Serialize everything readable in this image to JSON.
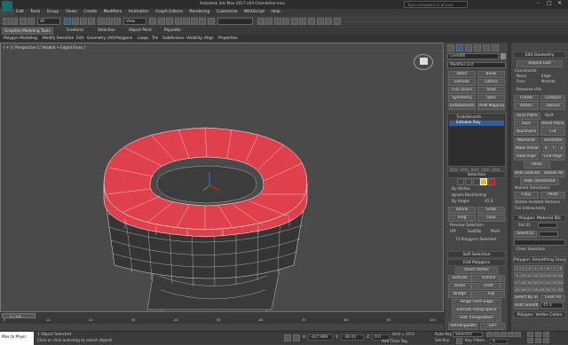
{
  "title": "Autodesk 3ds Max 2017 x64    Chandelier.max",
  "search_placeholder": "Type a keyword or phrase",
  "menu": [
    "Edit",
    "Tools",
    "Group",
    "Views",
    "Create",
    "Modifiers",
    "Animation",
    "Graph Editors",
    "Rendering",
    "Customize",
    "MAXScript",
    "Help"
  ],
  "toolbar": {
    "selection_set": "All",
    "view": "View"
  },
  "ribbon": {
    "tabs": [
      "Graphite Modeling Tools",
      "Freeform",
      "Selection",
      "Object Paint",
      "Populate"
    ],
    "sub": [
      "Polygon Modeling",
      "Modify Selection",
      "Edit",
      "Geometry (All)",
      "Polygons",
      "Loops",
      "Tris",
      "Subdivision",
      "Visibility",
      "Align",
      "Properties"
    ]
  },
  "viewport": {
    "label": "[ + ] [ Perspective ] [ Shaded + Edged Faces ]"
  },
  "modify_panel": {
    "object_name": "Line006",
    "modifier_list": "Modifier List",
    "buttons": [
      "Bend",
      "Bevel",
      "Extrude",
      "Lattice",
      "FFD 3x3x3",
      "Shell",
      "Symmetry",
      "Taper",
      "TurboSmooth",
      "UVW Mapping Cl..."
    ],
    "stack": [
      "TurboSmooth",
      "Editable Poly"
    ]
  },
  "selection_panel": {
    "title": "Selection",
    "by_vertex": "By Vertex",
    "ignore_backfacing": "Ignore Backfacing",
    "by_angle": "By Angle:",
    "by_angle_value": "45.0",
    "shrink": "Shrink",
    "grow": "Grow",
    "ring": "Ring",
    "loop": "Loop",
    "preview": "Preview Selection",
    "off": "Off",
    "subobj": "SubObj",
    "multi": "Multi",
    "status": "72 Polygons Selected",
    "soft": "Soft Selection"
  },
  "edit_polygons": {
    "title": "Edit Polygons",
    "insert_vertex": "Insert Vertex",
    "rows": [
      [
        "Extrude",
        "Outline"
      ],
      [
        "Bevel",
        "Inset"
      ],
      [
        "Bridge",
        "Flip"
      ]
    ],
    "hinge": "Hinge From Edge",
    "extrude_spline": "Extrude Along Spline",
    "edit_tri": "Edit Triangulation",
    "retri": "Retriangulate",
    "turn": "Turn"
  },
  "edit_geometry": {
    "title": "Edit Geometry",
    "repeat_last": "Repeat Last",
    "constraints": "Constraints",
    "none": "None",
    "edge": "Edge",
    "face": "Face",
    "normal": "Normal",
    "preserve_uvs": "Preserve UVs",
    "create": "Create",
    "collapse": "Collapse",
    "attach": "Attach",
    "detach": "Detach",
    "slice_plane": "Slice Plane",
    "split": "Split",
    "slice": "Slice",
    "reset_plane": "Reset Plane",
    "quickslice": "QuickSlice",
    "cut": "Cut",
    "msmooth": "MSmooth",
    "tessellate": "Tessellate",
    "make_planar": "Make Planar",
    "x": "X",
    "y": "Y",
    "z": "Z",
    "view_align": "View Align",
    "grid_align": "Grid Align",
    "relax": "Relax",
    "hide_selected": "Hide Selected",
    "unhide_all": "Unhide All",
    "hide_unselected": "Hide Unselected",
    "named_selections": "Named Selections:",
    "copy": "Copy",
    "paste": "Paste",
    "delete_isolated": "Delete Isolated Vertices",
    "full_interactivity": "Full Interactivity"
  },
  "material_ids": {
    "title": "Polygon: Material IDs",
    "set_id": "Set ID:",
    "select_id": "Select ID",
    "clear_selection": "Clear Selection"
  },
  "smoothing_groups": {
    "title": "Polygon: Smoothing Groups",
    "numbers": [
      "1",
      "2",
      "3",
      "4",
      "5",
      "6",
      "7",
      "8",
      "9",
      "10",
      "11",
      "12",
      "13",
      "14",
      "15",
      "16",
      "17",
      "18",
      "19",
      "20",
      "21",
      "22",
      "23",
      "24",
      "25",
      "26",
      "27",
      "28",
      "29",
      "30",
      "31",
      "32"
    ],
    "select_by_sg": "Select By SG",
    "clear_all": "Clear All",
    "auto_smooth": "Auto Smooth",
    "auto_smooth_value": "45.0"
  },
  "vertex_colors": {
    "title": "Polygon: Vertex Colors"
  },
  "timeline": {
    "position": "0 / 100",
    "ticks": [
      "0",
      "10",
      "20",
      "30",
      "40",
      "50",
      "60",
      "70",
      "80",
      "90",
      "100"
    ]
  },
  "status": {
    "script": "Max to Physc",
    "objects": "1 Object Selected",
    "prompt": "Click or click-and-drag to select objects",
    "x_label": "X:",
    "x_value": "-427.889",
    "y_label": "Y:",
    "y_value": "-36.43",
    "z_label": "Z:",
    "z_value": "0.0",
    "grid": "Grid = 10.0",
    "add_time_tag": "Add Time Tag",
    "auto_key": "Auto Key",
    "selected": "Selected",
    "set_key": "Set Key",
    "key_filters": "Key Filters...",
    "frame": "0"
  },
  "colors": {
    "selected_faces": "#e0404c",
    "panel": "#444444",
    "accent": "#2f5f9a"
  }
}
